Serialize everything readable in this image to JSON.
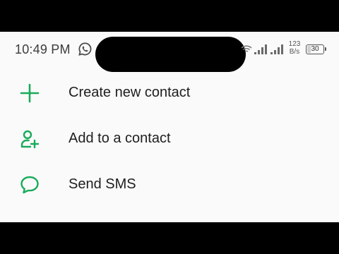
{
  "status_bar": {
    "time": "10:49 PM",
    "net_speed_value": "123",
    "net_speed_unit": "B/s",
    "battery_level": "30",
    "battery_fraction": 0.3,
    "icons": [
      "whatsapp-icon",
      "wifi-icon",
      "signal-icon",
      "signal-icon",
      "battery-icon"
    ]
  },
  "menu": {
    "items": [
      {
        "label": "Create new contact",
        "icon": "plus-icon"
      },
      {
        "label": "Add to a contact",
        "icon": "add-person-icon"
      },
      {
        "label": "Send SMS",
        "icon": "chat-bubble-icon"
      }
    ]
  },
  "colors": {
    "accent": "#1aab5b",
    "background": "#fafafa",
    "text": "#1e1e1e",
    "status_text": "#3c3c3c"
  }
}
